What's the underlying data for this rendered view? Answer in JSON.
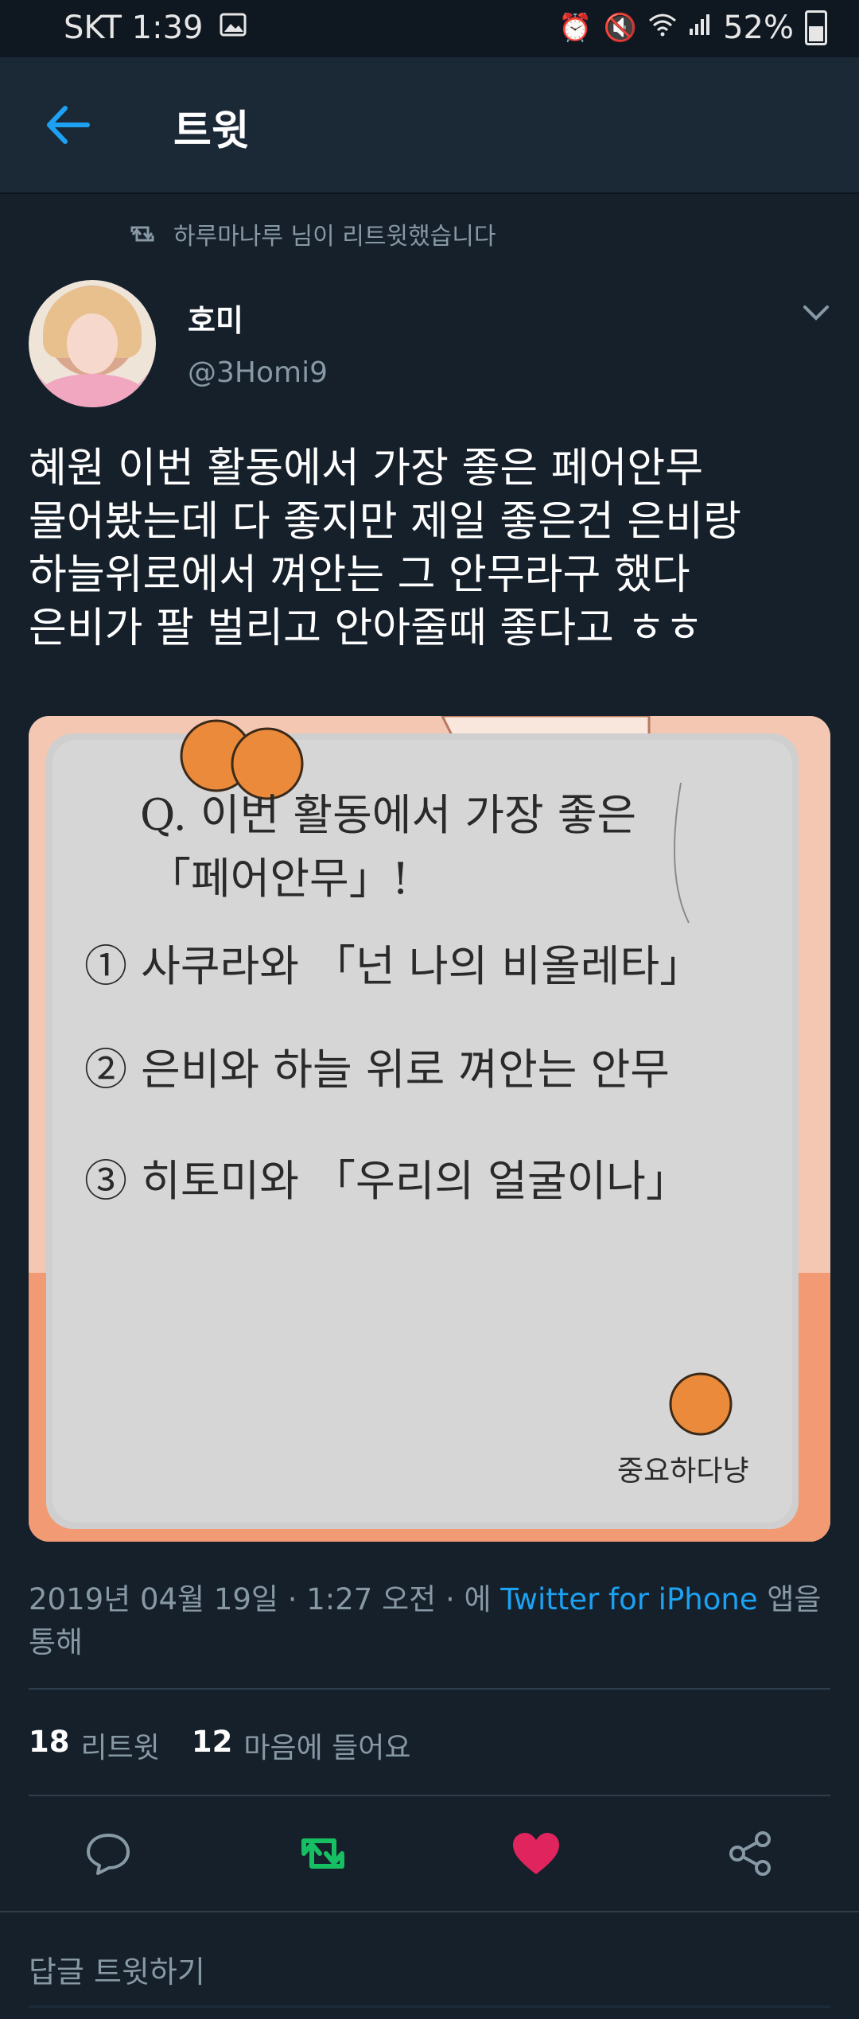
{
  "status_bar": {
    "carrier_time": "SKT 1:39",
    "battery": "52%",
    "icons": [
      "image-icon",
      "alarm-icon",
      "mute-icon",
      "wifi-icon",
      "signal-icon",
      "battery-icon"
    ]
  },
  "header": {
    "title": "트윗",
    "back_icon": "arrow-left-icon"
  },
  "retweet_note": {
    "text": "하루마나루 님이 리트윗했습니다",
    "icon": "retweet-icon"
  },
  "author": {
    "name": "호미",
    "handle": "@3Homi9"
  },
  "tweet": {
    "lines": [
      "혜원 이번 활동에서 가장 좋은 페어안무",
      "물어봤는데 다 좋지만 제일 좋은건 은비랑",
      "하늘위로에서 껴안는 그 안무라구 했다",
      "은비가 팔 벌리고 안아줄때 좋다고 ㅎㅎ"
    ]
  },
  "media_note": {
    "lines": [
      "Q. 이번 활동에서 가장 좋은",
      "「페어안무」!",
      "① 사쿠라와 「넌 나의 비올레타」",
      "② 은비와 하늘 위로 껴안는 안무",
      "③ 히토미와 「우리의 얼굴이나」"
    ],
    "signature": "중요하다냥"
  },
  "meta": {
    "date": "2019년 04월 19일 · 1:27 오전 · 에",
    "source": "Twitter for iPhone",
    "suffix": "앱을 통해"
  },
  "stats": {
    "retweets_count": "18",
    "retweets_label": "리트윗",
    "likes_count": "12",
    "likes_label": "마음에 들어요"
  },
  "actions": {
    "reply_icon": "reply-icon",
    "retweet_icon": "retweet-icon",
    "like_icon": "heart-icon",
    "share_icon": "share-icon",
    "colors": {
      "retweet": "#17bf63",
      "like": "#e0245e"
    }
  },
  "reply_bar": {
    "placeholder": "답글 트윗하기"
  }
}
